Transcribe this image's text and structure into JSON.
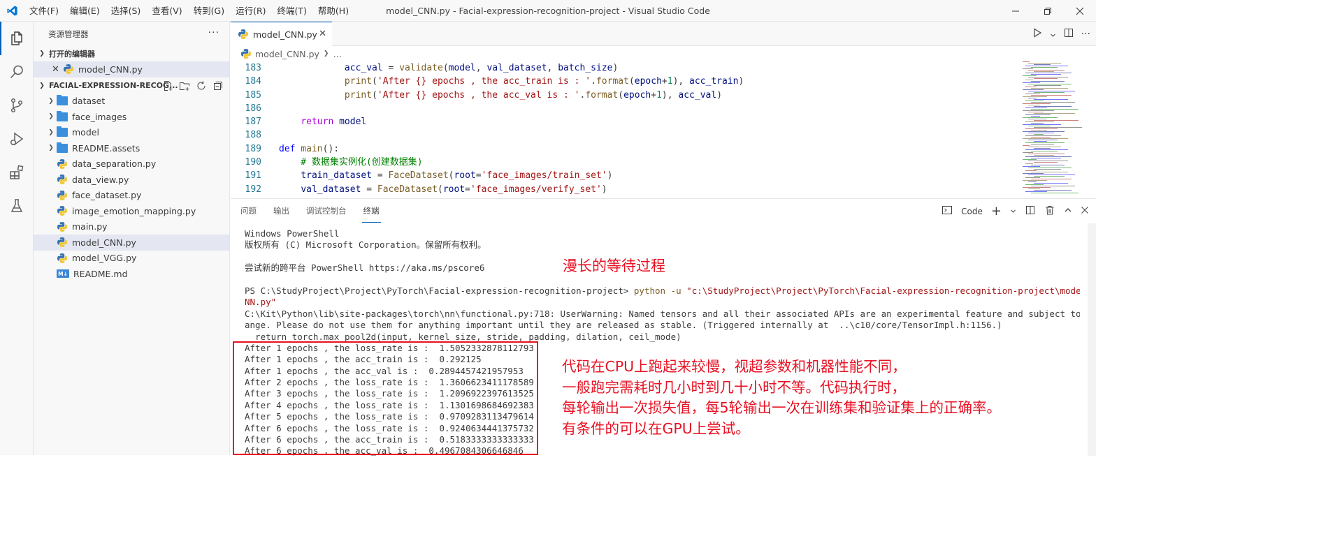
{
  "titlebar": {
    "menu": [
      "文件(F)",
      "编辑(E)",
      "选择(S)",
      "查看(V)",
      "转到(G)",
      "运行(R)",
      "终端(T)",
      "帮助(H)"
    ],
    "title": "model_CNN.py - Facial-expression-recognition-project - Visual Studio Code"
  },
  "sidebar": {
    "header": "资源管理器",
    "open_editors_title": "打开的编辑器",
    "open_editor_file": "model_CNN.py",
    "project_title": "FACIAL-EXPRESSION-RECOG...",
    "folders": [
      "dataset",
      "face_images",
      "model",
      "README.assets"
    ],
    "files": [
      "data_separation.py",
      "data_view.py",
      "face_dataset.py",
      "image_emotion_mapping.py",
      "main.py",
      "model_CNN.py",
      "model_VGG.py"
    ],
    "md_file": "README.md"
  },
  "editor": {
    "tab_label": "model_CNN.py",
    "breadcrumb_file": "model_CNN.py",
    "breadcrumb_more": "…",
    "lines": [
      {
        "n": "183",
        "t": "            acc_val = validate(model, val_dataset, batch_size)"
      },
      {
        "n": "184",
        "t": "            print('After {} epochs , the acc_train is : '.format(epoch+1), acc_train)"
      },
      {
        "n": "185",
        "t": "            print('After {} epochs , the acc_val is : '.format(epoch+1), acc_val)"
      },
      {
        "n": "186",
        "t": ""
      },
      {
        "n": "187",
        "t": "    return model"
      },
      {
        "n": "188",
        "t": ""
      },
      {
        "n": "189",
        "t": "def main():"
      },
      {
        "n": "190",
        "t": "    # 数据集实例化(创建数据集)"
      },
      {
        "n": "191",
        "t": "    train_dataset = FaceDataset(root='face_images/train_set')"
      },
      {
        "n": "192",
        "t": "    val_dataset = FaceDataset(root='face_images/verify_set')"
      }
    ]
  },
  "panel": {
    "tabs": [
      "问题",
      "输出",
      "调试控制台",
      "终端"
    ],
    "active_tab": "终端",
    "shell_label": "Code",
    "terminal": {
      "header": [
        "Windows PowerShell",
        "版权所有 (C) Microsoft Corporation。保留所有权利。",
        "",
        "尝试新的跨平台 PowerShell https://aka.ms/pscore6",
        ""
      ],
      "prompt": "PS C:\\StudyProject\\Project\\PyTorch\\Facial-expression-recognition-project> ",
      "cmd": "python -u ",
      "cmd_arg": "\"c:\\StudyProject\\Project\\PyTorch\\Facial-expression-recognition-project\\model_C",
      "cmd_arg_wrap": "NN.py\"",
      "warning": [
        "C:\\Kit\\Python\\lib\\site-packages\\torch\\nn\\functional.py:718: UserWarning: Named tensors and all their associated APIs are an experimental feature and subject to ch",
        "ange. Please do not use them for anything important until they are released as stable. (Triggered internally at  ..\\c10/core/TensorImpl.h:1156.)",
        "  return torch.max_pool2d(input, kernel_size, stride, padding, dilation, ceil_mode)"
      ],
      "results": [
        "After 1 epochs , the loss_rate is :  1.5052332878112793",
        "After 1 epochs , the acc_train is :  0.292125",
        "After 1 epochs , the acc_val is :  0.2894457421957953",
        "After 2 epochs , the loss_rate is :  1.3606623411178589",
        "After 3 epochs , the loss_rate is :  1.2096922397613525",
        "After 4 epochs , the loss_rate is :  1.1301698684692383",
        "After 5 epochs , the loss_rate is :  0.9709283113479614",
        "After 6 epochs , the loss_rate is :  0.9240634441375732",
        "After 6 epochs , the acc_train is :  0.5183333333333333",
        "After 6 epochs , the acc_val is :  0.4967084306646846"
      ]
    }
  },
  "annotations": {
    "wait": "漫长的等待过程",
    "note": [
      "代码在CPU上跑起来较慢，视超参数和机器性能不同，",
      "一般跑完需耗时几小时到几十小时不等。代码执行时，",
      "每轮输出一次损失值，每5轮输出一次在训练集和验证集上的正确率。",
      "有条件的可以在GPU上尝试。"
    ]
  },
  "colors": {
    "accent": "#005fb8",
    "annotation": "#e81123",
    "folder": "#3c8fdc"
  }
}
